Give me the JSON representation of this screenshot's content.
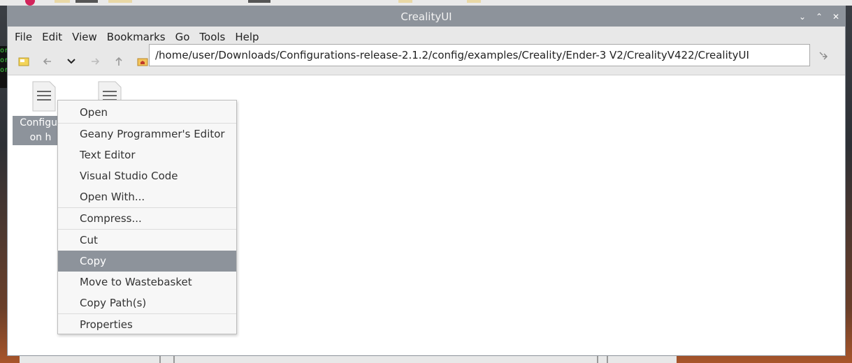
{
  "window": {
    "title": "CrealityUI",
    "controls": {
      "minimize": "⌄",
      "maximize": "⌃",
      "close": "✕"
    }
  },
  "menubar": {
    "items": [
      "File",
      "Edit",
      "View",
      "Bookmarks",
      "Go",
      "Tools",
      "Help"
    ]
  },
  "toolbar": {
    "path": "/home/user/Downloads/Configurations-release-2.1.2/config/examples/Creality/Ender-3 V2/CrealityV422/CrealityUI",
    "buttons": [
      "new-folder-icon",
      "back-icon",
      "history-dropdown-icon",
      "forward-icon",
      "up-icon",
      "home-icon",
      "go-icon"
    ]
  },
  "files": [
    {
      "label_line1": "Configur",
      "label_line2": "on h",
      "icon": "text-file-icon"
    },
    {
      "icon": "text-file-icon"
    }
  ],
  "terminal": {
    "lines": [
      "or",
      "or",
      "or"
    ]
  },
  "context_menu": {
    "items": [
      {
        "label": "Open"
      },
      {
        "label": "Geany Programmer's Editor"
      },
      {
        "label": "Text Editor"
      },
      {
        "label": "Visual Studio Code"
      },
      {
        "label": "Open With..."
      },
      {
        "label": "Compress..."
      },
      {
        "label": "Cut"
      },
      {
        "label": "Copy",
        "selected": true
      },
      {
        "label": "Move to Wastebasket"
      },
      {
        "label": "Copy Path(s)"
      },
      {
        "label": "Properties"
      }
    ]
  },
  "colors": {
    "titlebar": "#8d939b",
    "selection": "#8d939b",
    "menubar": "#e8e8e8"
  }
}
